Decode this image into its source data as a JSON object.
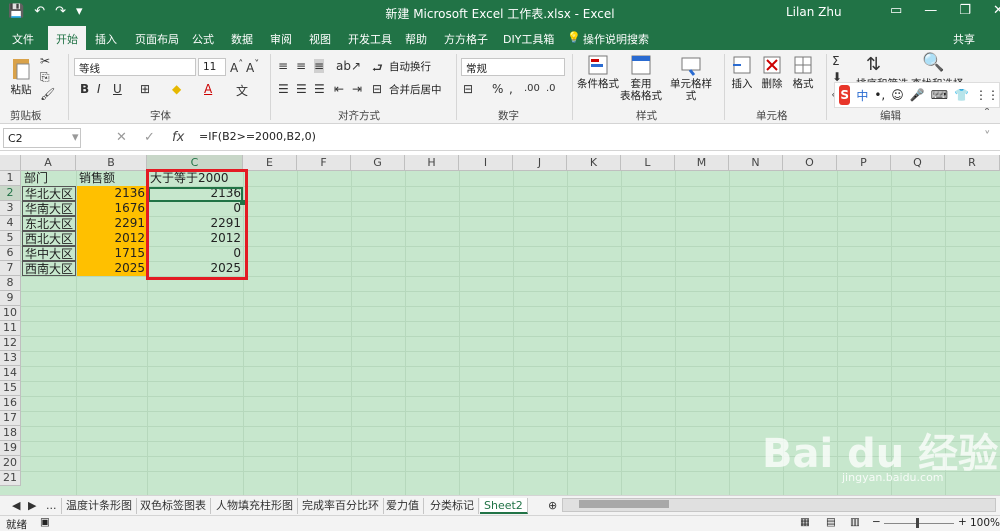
{
  "window": {
    "title": "新建 Microsoft Excel 工作表.xlsx - Excel",
    "user": "Lilan Zhu"
  },
  "tabs": [
    "文件",
    "开始",
    "插入",
    "页面布局",
    "公式",
    "数据",
    "审阅",
    "视图",
    "开发工具",
    "帮助",
    "方方格子",
    "DIY工具箱",
    "操作说明搜索"
  ],
  "share": "共享",
  "ribbon": {
    "paste": "粘贴",
    "font_name": "等线",
    "font_size": "11",
    "number_format": "常规",
    "wrap_text": "自动换行",
    "merge_center": "合并后居中",
    "cond_format": "条件格式",
    "table_format_1": "套用",
    "table_format_2": "表格格式",
    "cell_style": "单元格样式",
    "insert": "插入",
    "delete": "删除",
    "format": "格式",
    "sort_filter": "排序和筛选",
    "find_select": "查找和选择",
    "groups": [
      "剪贴板",
      "字体",
      "对齐方式",
      "数字",
      "样式",
      "单元格",
      "编辑"
    ],
    "ime_zh": "中"
  },
  "formula_bar": {
    "name_box": "C2",
    "fx": "fx",
    "formula": "=IF(B2>=2000,B2,0)"
  },
  "columns": [
    "A",
    "B",
    "C",
    "E",
    "F",
    "G",
    "H",
    "I",
    "J",
    "K",
    "L",
    "M",
    "N",
    "O",
    "P",
    "Q",
    "R"
  ],
  "rows": [
    "1",
    "2",
    "3",
    "4",
    "5",
    "6",
    "7",
    "8",
    "9",
    "10",
    "11",
    "12",
    "13",
    "14",
    "15",
    "16",
    "17",
    "18",
    "19",
    "20",
    "21"
  ],
  "cells": {
    "headers": {
      "a1": "部门",
      "b1": "销售额",
      "c1": "大于等于2000"
    },
    "data": [
      {
        "dept": "华北大区",
        "sales": "2136",
        "result": "2136"
      },
      {
        "dept": "华南大区",
        "sales": "1676",
        "result": "0"
      },
      {
        "dept": "东北大区",
        "sales": "2291",
        "result": "2291"
      },
      {
        "dept": "西北大区",
        "sales": "2012",
        "result": "2012"
      },
      {
        "dept": "华中大区",
        "sales": "1715",
        "result": "0"
      },
      {
        "dept": "西南大区",
        "sales": "2025",
        "result": "2025"
      }
    ]
  },
  "sheet_tabs": {
    "more": "...",
    "items": [
      "温度计条形图",
      "双色标签图表",
      "人物填充柱形图",
      "完成率百分比环",
      "爱力值",
      "分类标记",
      "Sheet2"
    ],
    "active": "Sheet2"
  },
  "status": {
    "ready": "就绪",
    "zoom": "100%"
  },
  "watermark": {
    "logo": "Bai du 经验",
    "site": "jingyan.baidu.com"
  }
}
